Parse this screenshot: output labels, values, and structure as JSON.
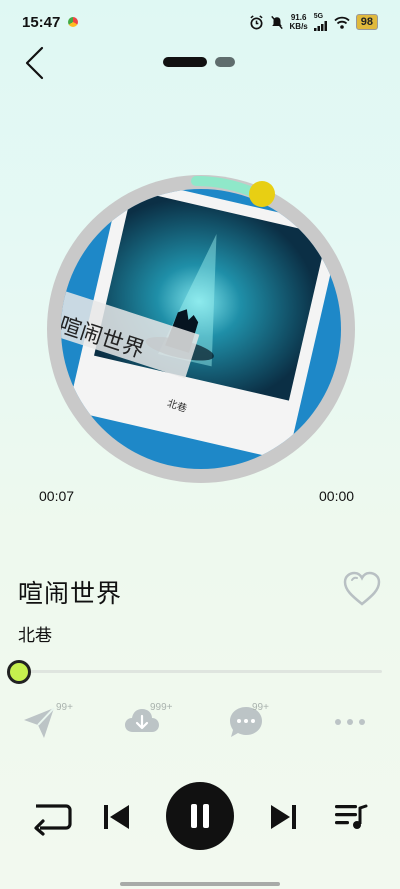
{
  "status": {
    "time": "15:47",
    "speed_value": "91.6",
    "speed_unit": "KB/s",
    "network": "5G",
    "battery": "98"
  },
  "player": {
    "album_art_text": "喧闹世界",
    "album_art_artist": "北巷",
    "current_time": "00:07",
    "total_time": "00:00",
    "progress": 0.0
  },
  "song": {
    "title": "喧闹世界",
    "artist": "北巷"
  },
  "actions": {
    "share_badge": "99+",
    "download_badge": "999+",
    "comment_badge": "99+"
  },
  "icons": [
    "back-icon",
    "heart-icon",
    "share-icon",
    "download-icon",
    "comment-icon",
    "more-icon",
    "repeat-icon",
    "previous-icon",
    "pause-icon",
    "next-icon",
    "playlist-icon"
  ],
  "colors": {
    "accent_knob": "#c6f04e",
    "disc_blue": "#1e88c8",
    "progress_arc": "#8fe8c9",
    "arc_dot": "#e8cf13"
  }
}
